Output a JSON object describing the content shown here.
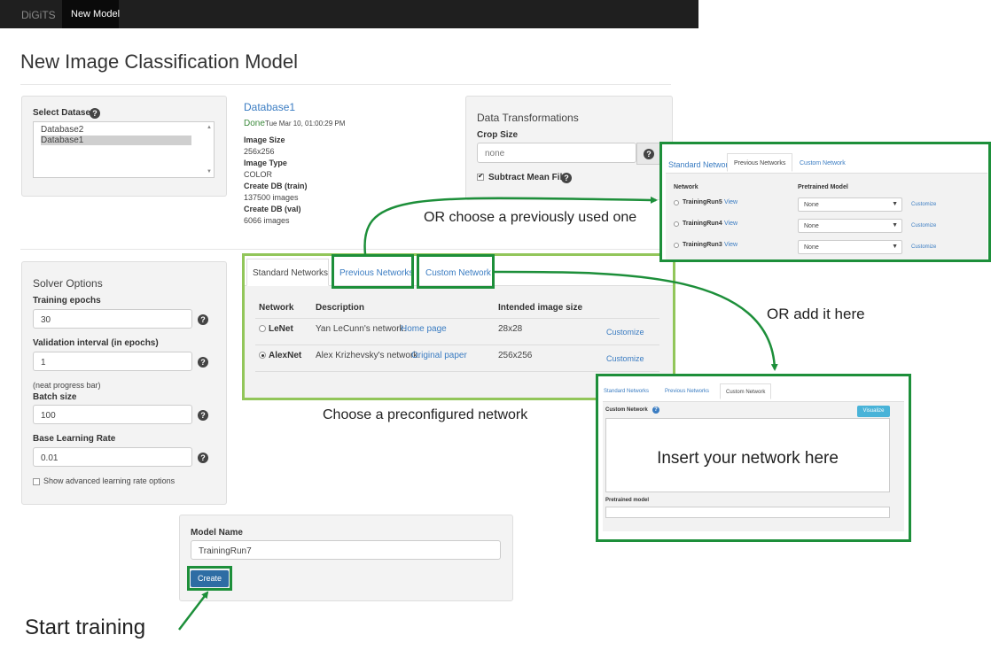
{
  "navbar": {
    "brand": "DiGiTS",
    "active_tab": "New Model"
  },
  "page_title": "New Image Classification Model",
  "dataset": {
    "label": "Select Dataset",
    "options": [
      "Database2",
      "Database1"
    ],
    "selected": "Database1",
    "info": {
      "name": "Database1",
      "status": "Done",
      "timestamp": "Tue Mar 10, 01:00:29 PM",
      "image_size_label": "Image Size",
      "image_size": "256x256",
      "image_type_label": "Image Type",
      "image_type": "COLOR",
      "train_label": "Create DB (train)",
      "train_value": "137500 images",
      "val_label": "Create DB (val)",
      "val_value": "6066 images"
    }
  },
  "transforms": {
    "title": "Data Transformations",
    "crop_label": "Crop Size",
    "crop_placeholder": "none",
    "subtract_label": "Subtract Mean File"
  },
  "solver": {
    "title": "Solver Options",
    "epochs_label": "Training epochs",
    "epochs_value": "30",
    "val_interval_label": "Validation interval (in epochs)",
    "val_interval_value": "1",
    "neat_note": "(neat progress bar)",
    "batch_label": "Batch size",
    "batch_value": "100",
    "lr_label": "Base Learning Rate",
    "lr_value": "0.01",
    "advanced_label": "Show advanced learning rate options"
  },
  "networks": {
    "tabs": [
      "Standard Networks",
      "Previous Networks",
      "Custom Network"
    ],
    "headers": [
      "Network",
      "Description",
      "Intended image size"
    ],
    "rows": [
      {
        "name": "LeNet",
        "desc": "Yan LeCunn's network.",
        "link": "Home page",
        "size": "28x28",
        "action": "Customize"
      },
      {
        "name": "AlexNet",
        "desc": "Alex Krizhevsky's network.",
        "link": "Original paper",
        "size": "256x256",
        "action": "Customize"
      }
    ]
  },
  "previous_popup": {
    "tabs": [
      "Standard Networks",
      "Previous Networks",
      "Custom Network"
    ],
    "headers": [
      "Network",
      "Pretrained Model"
    ],
    "rows": [
      {
        "name": "TrainingRun5",
        "view": "View",
        "select": "None",
        "action": "Customize"
      },
      {
        "name": "TrainingRun4",
        "view": "View",
        "select": "None",
        "action": "Customize"
      },
      {
        "name": "TrainingRun3",
        "view": "View",
        "select": "None",
        "action": "Customize"
      }
    ]
  },
  "custom_popup": {
    "tabs": [
      "Standard Networks",
      "Previous Networks",
      "Custom Network"
    ],
    "label": "Custom Network",
    "visualize": "Visualize",
    "textarea_text": "Insert your network here",
    "pretrained_label": "Pretrained model"
  },
  "model": {
    "name_label": "Model Name",
    "name_value": "TrainingRun7",
    "create": "Create"
  },
  "callouts": {
    "previous": "OR choose a previously used one",
    "custom": "OR add it here",
    "preconfigured": "Choose a preconfigured network",
    "start": "Start training"
  },
  "colors": {
    "accent": "#1d8f3a",
    "light_accent": "#92c65a",
    "link": "#3a7cc2",
    "button": "#2e6da4"
  }
}
